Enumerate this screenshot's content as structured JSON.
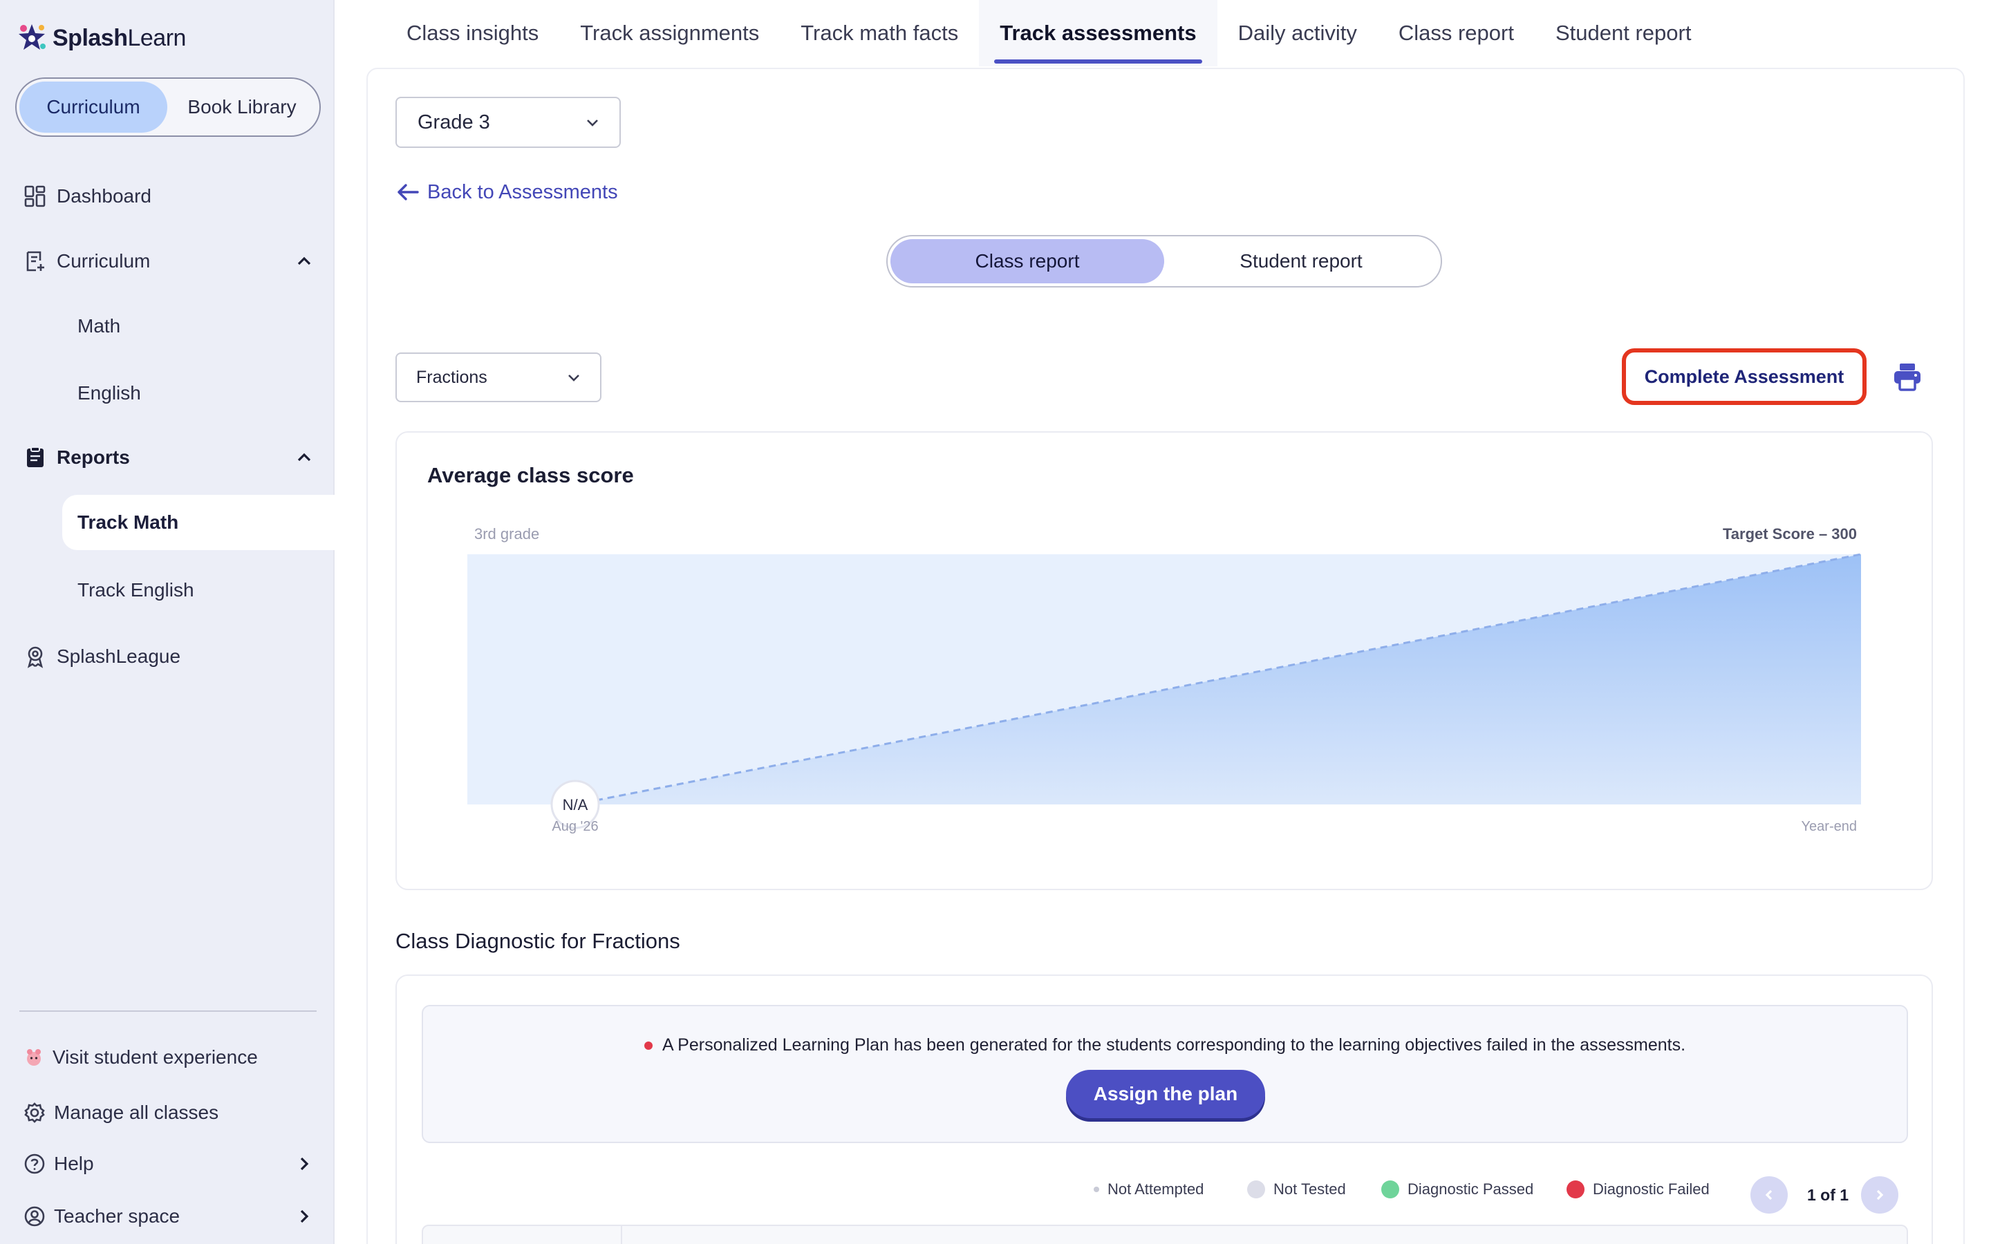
{
  "brand": {
    "name_bold": "Splash",
    "name_regular": "Learn"
  },
  "sidebar": {
    "toggle": {
      "active": "Curriculum",
      "inactive": "Book Library"
    },
    "nav": {
      "dashboard": "Dashboard",
      "curriculum": "Curriculum",
      "math": "Math",
      "english": "English",
      "reports": "Reports",
      "track_math": "Track Math",
      "track_english": "Track English",
      "splashleague": "SplashLeague"
    },
    "footer": {
      "visit_student": "Visit student experience",
      "manage_classes": "Manage all classes",
      "help": "Help",
      "teacher_space": "Teacher space"
    }
  },
  "tabs": [
    "Class insights",
    "Track assignments",
    "Track math facts",
    "Track assessments",
    "Daily activity",
    "Class report",
    "Student report"
  ],
  "active_tab": "Track assessments",
  "filters": {
    "grade": "Grade 3",
    "topic": "Fractions"
  },
  "back_link": "Back to Assessments",
  "report_toggle": {
    "active": "Class report",
    "inactive": "Student report"
  },
  "actions": {
    "complete": "Complete Assessment",
    "print_icon": "printer-icon"
  },
  "chart": {
    "title": "Average class score",
    "grade_label": "3rd grade",
    "target_label": "Target Score – 300",
    "point_label": "N/A",
    "start_label": "Aug '26",
    "end_label": "Year-end"
  },
  "chart_data": {
    "type": "area",
    "title": "Average class score",
    "x": [
      "Aug '26",
      "Year-end"
    ],
    "series": [
      {
        "name": "",
        "values": [
          null,
          300
        ]
      }
    ],
    "annotations": [
      "3rd grade",
      "Target Score – 300",
      "N/A"
    ],
    "colors": {
      "fill": "#a9c8f7",
      "line": "#9db9ee"
    }
  },
  "diagnostic": {
    "title": "Class Diagnostic for Fractions",
    "message": "A Personalized Learning Plan has been generated for the students corresponding to the learning objectives failed in the assessments.",
    "assign_button": "Assign the plan",
    "legend": {
      "not_attempted": "Not Attempted",
      "not_tested": "Not Tested",
      "passed": "Diagnostic Passed",
      "failed": "Diagnostic Failed"
    },
    "pager": "1 of 1"
  },
  "colors": {
    "accent": "#4c4fc3",
    "highlight": "#e4361f",
    "passed": "#6fd49a",
    "failed": "#e2394a",
    "not_tested": "#dcdde8",
    "not_attempted": "#c8cad6"
  }
}
